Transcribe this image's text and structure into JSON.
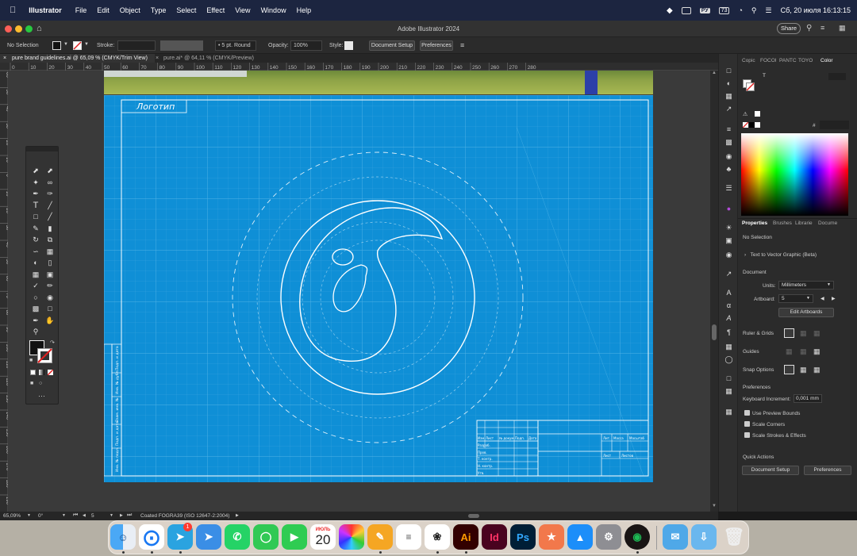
{
  "menubar": {
    "app_name": "Illustrator",
    "items": [
      "File",
      "Edit",
      "Object",
      "Type",
      "Select",
      "Effect",
      "View",
      "Window",
      "Help"
    ],
    "input_lang": "РУ",
    "battery": "73",
    "datetime": "Сб, 20 июля  16:13:15"
  },
  "window": {
    "title": "Adobe Illustrator 2024",
    "share_label": "Share"
  },
  "controlbar": {
    "selection": "No Selection",
    "stroke_label": "Stroke:",
    "brush_value": "5 pt. Round",
    "opacity_label": "Opacity:",
    "opacity_value": "100%",
    "style_label": "Style:",
    "doc_setup_label": "Document Setup",
    "preferences_label": "Preferences"
  },
  "tabs": [
    {
      "label": "pure brand guidelines.ai @ 65,09 % (CMYK/Trim View)",
      "active": true
    },
    {
      "label": "pure.ai* @ 64,11 % (CMYK/Preview)",
      "active": false
    }
  ],
  "ruler_h_ticks": [
    "0",
    "10",
    "20",
    "30",
    "40",
    "50",
    "60",
    "70",
    "80",
    "90",
    "100",
    "110",
    "120",
    "130",
    "140",
    "150",
    "160",
    "170",
    "180",
    "190",
    "200",
    "210",
    "220",
    "230",
    "240",
    "250",
    "260",
    "270",
    "280"
  ],
  "ruler_v_ticks": [
    "60",
    "50",
    "40",
    "30",
    "20",
    "10",
    "0",
    "10",
    "20",
    "30",
    "40",
    "50",
    "60",
    "70",
    "80",
    "90",
    "100",
    "110",
    "120",
    "130",
    "140",
    "150",
    "160",
    "170",
    "180",
    "190",
    "200"
  ],
  "artwork": {
    "logo_text": "Логотип",
    "colors": {
      "blueprint": "#0f8fd6",
      "grid": "#3aa5e0",
      "line": "#ffffff"
    },
    "stamp_cells": [
      "Изм.",
      "Лист",
      "№ докум.",
      "Подп.",
      "Дата",
      "Разраб.",
      "Пров.",
      "Т. контр.",
      "Н. контр.",
      "Утв.",
      "Лит.",
      "Масса",
      "Масштаб",
      "Лист",
      "Листов"
    ],
    "side_strip": [
      "Инв. № подл.",
      "Подп. и дата",
      "Взам. инв. №",
      "Инв. № дубл.",
      "Подп. и дата"
    ]
  },
  "panel_tabs": [
    {
      "label": "Copic",
      "active": false
    },
    {
      "label": "FOCOI",
      "active": false
    },
    {
      "label": "PANTC",
      "active": false
    },
    {
      "label": "TOYO",
      "active": false
    },
    {
      "label": "Color",
      "active": true
    }
  ],
  "color_panel": {
    "channel_label": "T",
    "hex_label": "#"
  },
  "properties": {
    "tabs": [
      "Properties",
      "Brushes",
      "Librarie",
      "Docume"
    ],
    "selection": "No Selection",
    "text_to_vector": "Text to Vector Graphic (Beta)",
    "document_heading": "Document",
    "units_label": "Units:",
    "units_value": "Millimeters",
    "artboard_label": "Artboard:",
    "artboard_value": "5",
    "edit_artboards": "Edit Artboards",
    "ruler_grids": "Ruler & Grids",
    "guides": "Guides",
    "snap_options": "Snap Options",
    "preferences_heading": "Preferences",
    "keyboard_increment_label": "Keyboard Increment:",
    "keyboard_increment_value": "0,001 mm",
    "use_preview_bounds": "Use Preview Bounds",
    "scale_corners": "Scale Corners",
    "scale_strokes": "Scale Strokes & Effects",
    "quick_actions": "Quick Actions",
    "doc_setup_btn": "Document Setup",
    "preferences_btn": "Preferences"
  },
  "statusbar": {
    "zoom": "65,09%",
    "rotation": "0°",
    "artboard_nav": "5",
    "profile": "Coated FOGRA39 (ISO 12647-2:2004)"
  },
  "dock": {
    "calendar_month": "ИЮЛЬ",
    "calendar_day": "20",
    "telegram_badge": "1",
    "apps": [
      "Finder",
      "Safari",
      "Telegram",
      "Maps",
      "WhatsApp",
      "Messages",
      "FaceTime",
      "Calendar",
      "Photos",
      "Pages",
      "Reminders",
      "ChatGPT",
      "Illustrator",
      "InDesign",
      "Photoshop",
      "Figma",
      "App Store",
      "System Settings",
      "Spotify",
      "Mail",
      "Downloads",
      "Trash"
    ],
    "illustrator_label": "Ai",
    "indesign_label": "Id",
    "photoshop_label": "Ps"
  }
}
